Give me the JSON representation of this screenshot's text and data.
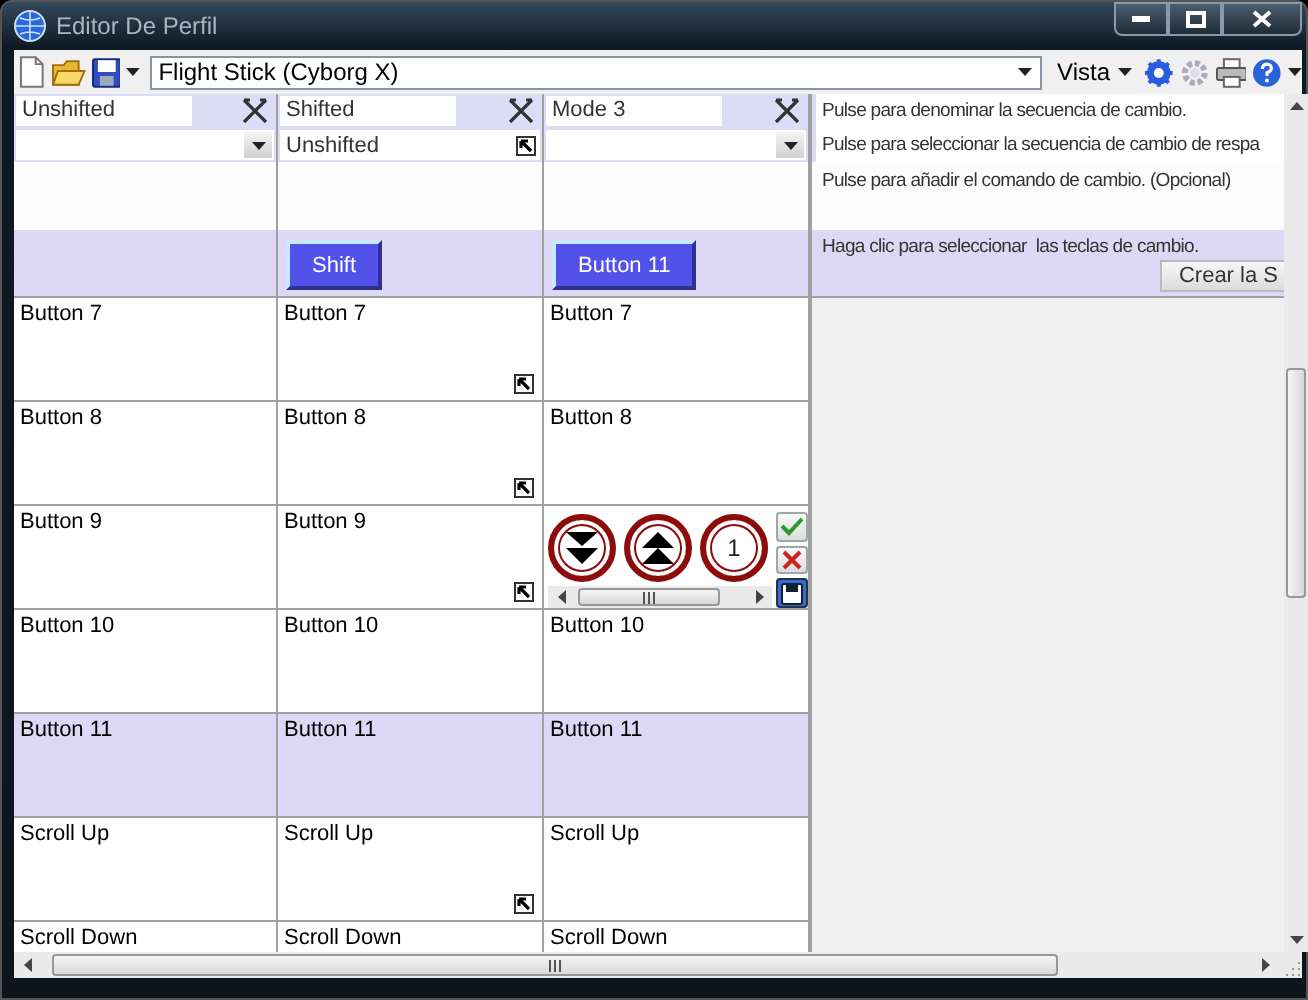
{
  "window": {
    "title": "Editor De Perfil"
  },
  "toolbar": {
    "profile": "Flight Stick (Cyborg X)",
    "view_menu": "Vista"
  },
  "modes": [
    {
      "name": "Unshifted",
      "shift_from": {
        "kind": "dropdown"
      }
    },
    {
      "name": "Shifted",
      "shift_from": {
        "kind": "linked",
        "value": "Unshifted"
      },
      "shift_key": "Shift"
    },
    {
      "name": "Mode 3",
      "shift_from": {
        "kind": "dropdown"
      },
      "shift_key": "Button 11"
    }
  ],
  "hints": {
    "name": "Pulse para denominar la secuencia de cambio.",
    "source": "Pulse para seleccionar la secuencia de cambio de respa",
    "command": "Pulse para añadir el comando de cambio. (Opcional)",
    "keys": "Haga clic para seleccionar  las teclas de cambio.",
    "create_button": "Crear la S"
  },
  "rows": [
    {
      "selected": false,
      "cells": [
        {
          "kind": "text",
          "text": "Button 7",
          "linked": false
        },
        {
          "kind": "text",
          "text": "Button 7",
          "linked": true
        },
        {
          "kind": "text",
          "text": "Button 7",
          "linked": false
        }
      ]
    },
    {
      "selected": false,
      "cells": [
        {
          "kind": "text",
          "text": "Button 8",
          "linked": false
        },
        {
          "kind": "text",
          "text": "Button 8",
          "linked": true
        },
        {
          "kind": "text",
          "text": "Button 8",
          "linked": false
        }
      ]
    },
    {
      "selected": false,
      "cells": [
        {
          "kind": "text",
          "text": "Button 9",
          "linked": false
        },
        {
          "kind": "text",
          "text": "Button 9",
          "linked": true
        },
        {
          "kind": "editor",
          "dials": [
            {
              "kind": "down"
            },
            {
              "kind": "up"
            },
            {
              "kind": "count",
              "label": "1"
            }
          ]
        }
      ]
    },
    {
      "selected": false,
      "cells": [
        {
          "kind": "text",
          "text": "Button 10",
          "linked": false
        },
        {
          "kind": "text",
          "text": "Button 10",
          "linked": false
        },
        {
          "kind": "text",
          "text": "Button 10",
          "linked": false
        }
      ]
    },
    {
      "selected": true,
      "cells": [
        {
          "kind": "text",
          "text": "Button 11",
          "linked": false
        },
        {
          "kind": "text",
          "text": "Button 11",
          "linked": false
        },
        {
          "kind": "text",
          "text": "Button 11",
          "linked": false
        }
      ]
    },
    {
      "selected": false,
      "cells": [
        {
          "kind": "text",
          "text": "Scroll Up",
          "linked": false
        },
        {
          "kind": "text",
          "text": "Scroll Up",
          "linked": true
        },
        {
          "kind": "text",
          "text": "Scroll Up",
          "linked": false
        }
      ]
    },
    {
      "selected": false,
      "cells": [
        {
          "kind": "text",
          "text": "Scroll Down"
        },
        {
          "kind": "text",
          "text": "Scroll Down"
        },
        {
          "kind": "text",
          "text": "Scroll Down"
        }
      ]
    }
  ]
}
